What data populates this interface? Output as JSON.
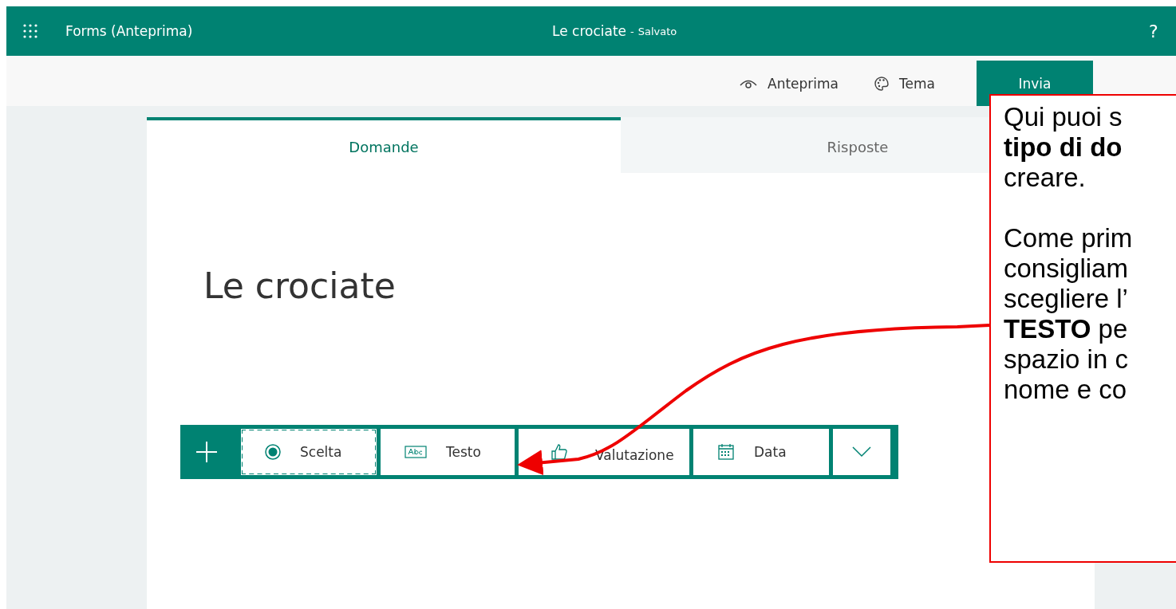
{
  "app_bar": {
    "app_name": "Forms (Anteprima)",
    "form_title": "Le crociate",
    "separator": "-",
    "save_status": "Salvato",
    "help": "?"
  },
  "command_bar": [
    {
      "kind": "preview",
      "label": "Anteprima"
    },
    {
      "kind": "theme",
      "label": "Tema"
    },
    {
      "kind": "send",
      "label": "Invia"
    }
  ],
  "tabs": [
    {
      "label": "Domande",
      "selected": true
    },
    {
      "label": "Risposte",
      "selected": false
    }
  ],
  "form": {
    "title": "Le crociate"
  },
  "question_types": [
    {
      "kind": "choice",
      "label": "Scelta",
      "selected": true
    },
    {
      "kind": "text",
      "label": "Testo",
      "selected": false
    },
    {
      "kind": "rating",
      "label": "Valutazione",
      "selected": false
    },
    {
      "kind": "date",
      "label": "Data",
      "selected": false
    }
  ],
  "callout": {
    "lines": [
      {
        "text": "Qui puoi s",
        "bold": false
      },
      {
        "text": "tipo di do",
        "bold": true
      },
      {
        "text": "creare.",
        "bold": false
      },
      {
        "text": "Come prim",
        "bold": false
      },
      {
        "text": "consigliam",
        "bold": false
      },
      {
        "text": "scegliere l’",
        "bold": false
      },
      {
        "text": "**TESTO** pe",
        "bold": false
      },
      {
        "text": "spazio in c",
        "bold": false
      },
      {
        "text": "nome e co",
        "bold": false
      }
    ]
  }
}
